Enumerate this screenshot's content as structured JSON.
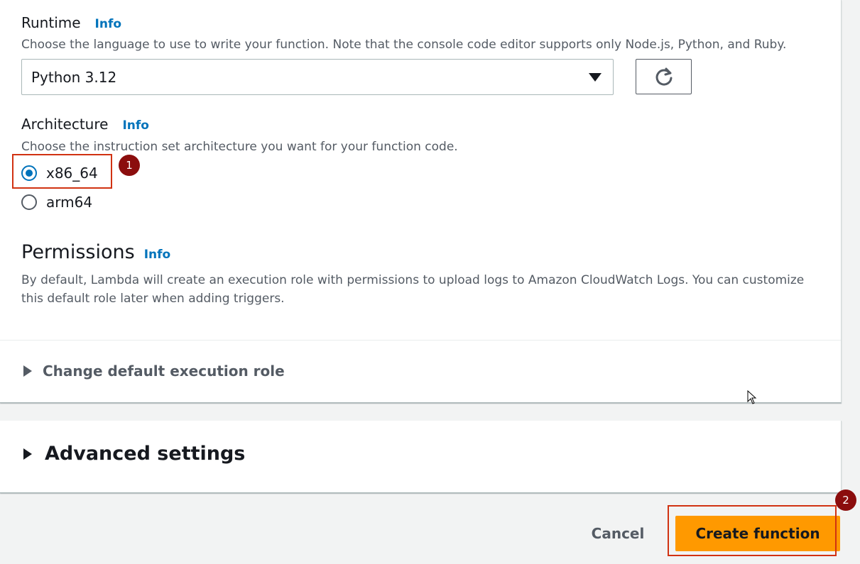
{
  "runtime": {
    "label": "Runtime",
    "info": "Info",
    "description": "Choose the language to use to write your function. Note that the console code editor supports only Node.js, Python, and Ruby.",
    "selected": "Python 3.12",
    "refresh_icon": "refresh-icon"
  },
  "architecture": {
    "label": "Architecture",
    "info": "Info",
    "description": "Choose the instruction set architecture you want for your function code.",
    "options": [
      {
        "label": "x86_64",
        "checked": true
      },
      {
        "label": "arm64",
        "checked": false
      }
    ]
  },
  "permissions": {
    "title": "Permissions",
    "info": "Info",
    "description_line1": "By default, Lambda will create an execution role with permissions to upload logs to Amazon CloudWatch Logs. You can customize",
    "description_line2": "this default role later when adding triggers.",
    "expander": "Change default execution role"
  },
  "advanced": {
    "label": "Advanced settings"
  },
  "footer": {
    "cancel": "Cancel",
    "create": "Create function"
  },
  "annotations": {
    "step1": "1",
    "step2": "2"
  },
  "colors": {
    "accent": "#0073bb",
    "primary_button": "#ff9900",
    "highlight": "#d13212",
    "badge": "#8b0d0d"
  }
}
